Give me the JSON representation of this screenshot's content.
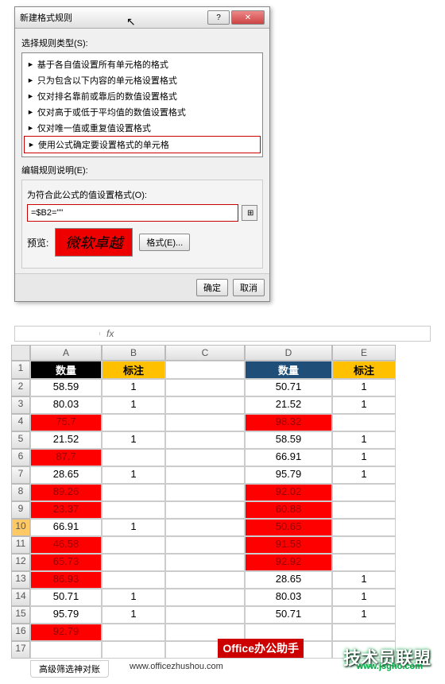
{
  "dialog": {
    "title": "新建格式规则",
    "select_rule_type_label": "选择规则类型(S):",
    "rules": [
      "基于各自值设置所有单元格的格式",
      "只为包含以下内容的单元格设置格式",
      "仅对排名靠前或靠后的数值设置格式",
      "仅对高于或低于平均值的数值设置格式",
      "仅对唯一值或重复值设置格式",
      "使用公式确定要设置格式的单元格"
    ],
    "edit_rule_label": "编辑规则说明(E):",
    "formula_label": "为符合此公式的值设置格式(O):",
    "formula_value": "=$B2=\"\"",
    "preview_label": "预览:",
    "preview_text": "微软卓越",
    "format_btn": "格式(E)...",
    "ok": "确定",
    "cancel": "取消"
  },
  "excel": {
    "cols": [
      "A",
      "B",
      "C",
      "D",
      "E"
    ],
    "headers": {
      "A": "数量",
      "B": "标注",
      "D": "数量",
      "E": "标注"
    },
    "rows": [
      {
        "n": 1
      },
      {
        "n": 2,
        "A": "58.59",
        "B": "1",
        "D": "50.71",
        "E": "1"
      },
      {
        "n": 3,
        "A": "80.03",
        "B": "1",
        "D": "21.52",
        "E": "1"
      },
      {
        "n": 4,
        "A": "75.7",
        "Ared": true,
        "D": "98.32",
        "Dred": true
      },
      {
        "n": 5,
        "A": "21.52",
        "B": "1",
        "D": "58.59",
        "E": "1"
      },
      {
        "n": 6,
        "A": "87.7",
        "Ared": true,
        "D": "66.91",
        "E": "1"
      },
      {
        "n": 7,
        "A": "28.65",
        "B": "1",
        "D": "95.79",
        "E": "1"
      },
      {
        "n": 8,
        "A": "89.26",
        "Ared": true,
        "D": "92.02",
        "Dred": true
      },
      {
        "n": 9,
        "A": "23.37",
        "Ared": true,
        "D": "60.88",
        "Dred": true
      },
      {
        "n": 10,
        "A": "66.91",
        "B": "1",
        "D": "50.65",
        "Dred": true,
        "sel": true
      },
      {
        "n": 11,
        "A": "46.58",
        "Ared": true,
        "D": "91.58",
        "Dred": true
      },
      {
        "n": 12,
        "A": "65.73",
        "Ared": true,
        "D": "92.92",
        "Dred": true
      },
      {
        "n": 13,
        "A": "86.93",
        "Ared": true,
        "D": "28.65",
        "E": "1"
      },
      {
        "n": 14,
        "A": "50.71",
        "B": "1",
        "D": "80.03",
        "E": "1"
      },
      {
        "n": 15,
        "A": "95.79",
        "B": "1",
        "D": "50.71",
        "E": "1"
      },
      {
        "n": 16,
        "A": "92.79",
        "Ared": true,
        "D": "",
        "E": ""
      },
      {
        "n": 17
      }
    ],
    "tab": "高级筛选神对账",
    "wm_red": "Office办公助手",
    "wm_big": "技术员联盟",
    "url1": "www.officezhushou.com",
    "url2": "www.jsgho.com"
  }
}
